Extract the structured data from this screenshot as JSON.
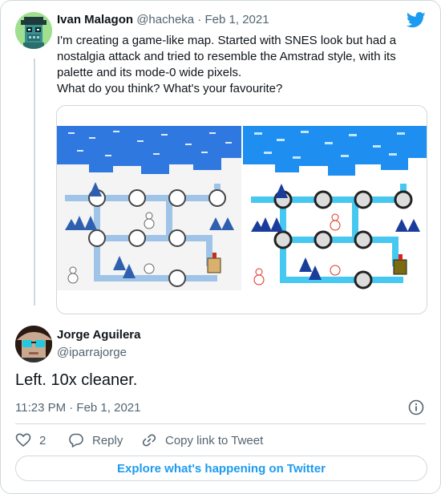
{
  "original_tweet": {
    "author_name": "Ivan Malagon",
    "author_handle": "@hacheka",
    "separator": " · ",
    "date": "Feb 1, 2021",
    "text_lines": [
      "I'm creating a game-like map. Started with SNES look but had a",
      "nostalgia attack and tried to resemble the Amstrad style, with its",
      "palette and its mode-0 wide pixels.",
      "What do you think? What's your favourite?"
    ]
  },
  "reply_tweet": {
    "author_name": "Jorge Aguilera",
    "author_handle": "@iparrajorge",
    "text": "Left. 10x cleaner.",
    "timestamp": "11:23 PM · Feb 1, 2021"
  },
  "actions": {
    "like_count": "2",
    "reply_label": "Reply",
    "copy_link_label": "Copy link to Tweet"
  },
  "footer": {
    "explore_label": "Explore what's happening on Twitter"
  },
  "colors": {
    "twitter_blue": "#1d9bf0",
    "text_primary": "#0f1419",
    "text_secondary": "#536471",
    "border": "#cfd9de"
  },
  "icons": {
    "brand": "twitter-bird-icon",
    "info": "info-icon",
    "like": "heart-icon",
    "reply": "speech-bubble-icon",
    "copy_link": "link-icon"
  }
}
